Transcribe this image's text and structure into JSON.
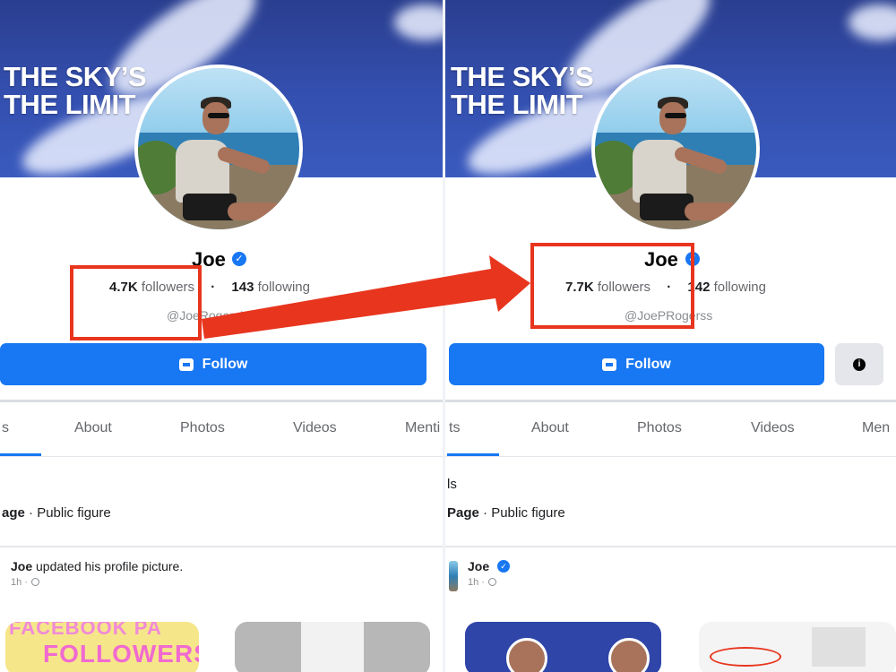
{
  "left": {
    "cover_line1": "THE SKY’S",
    "cover_line2": "THE LIMIT",
    "name": "Joe",
    "followers_count": "4.7K",
    "followers_label": "followers",
    "following_count": "143",
    "following_label": "following",
    "handle": "@JoeRogersUK",
    "follow_label": "Follow",
    "tabs": [
      "s",
      "About",
      "Photos",
      "Videos",
      "Menti"
    ],
    "page_label": "age",
    "page_category": "· Public figure",
    "post_author": "Joe",
    "post_action": " updated his profile picture.",
    "post_time": "1h ·",
    "thumb_text": "FOLLOWERS",
    "thumb_text_top": "FACEBOOK PA"
  },
  "right": {
    "cover_line1": "THE SKY’S",
    "cover_line2": "THE LIMIT",
    "name": "Joe",
    "followers_count": "7.7K",
    "followers_label": "followers",
    "following_count": "142",
    "following_label": "following",
    "handle": "@JoePRogerss",
    "follow_label": "Follow",
    "tabs": [
      "ts",
      "About",
      "Photos",
      "Videos",
      "Men"
    ],
    "section_fragment": "ls",
    "page_label": "Page",
    "page_category": "· Public figure",
    "post_author": "Joe",
    "post_time": "1h ·"
  },
  "colors": {
    "facebook_blue": "#1877f2",
    "highlight_red": "#e8351e",
    "cover_blue": "#3450b0"
  },
  "icons": [
    "verified-badge-icon",
    "follow-icon",
    "info-icon",
    "globe-icon",
    "arrow-icon"
  ]
}
